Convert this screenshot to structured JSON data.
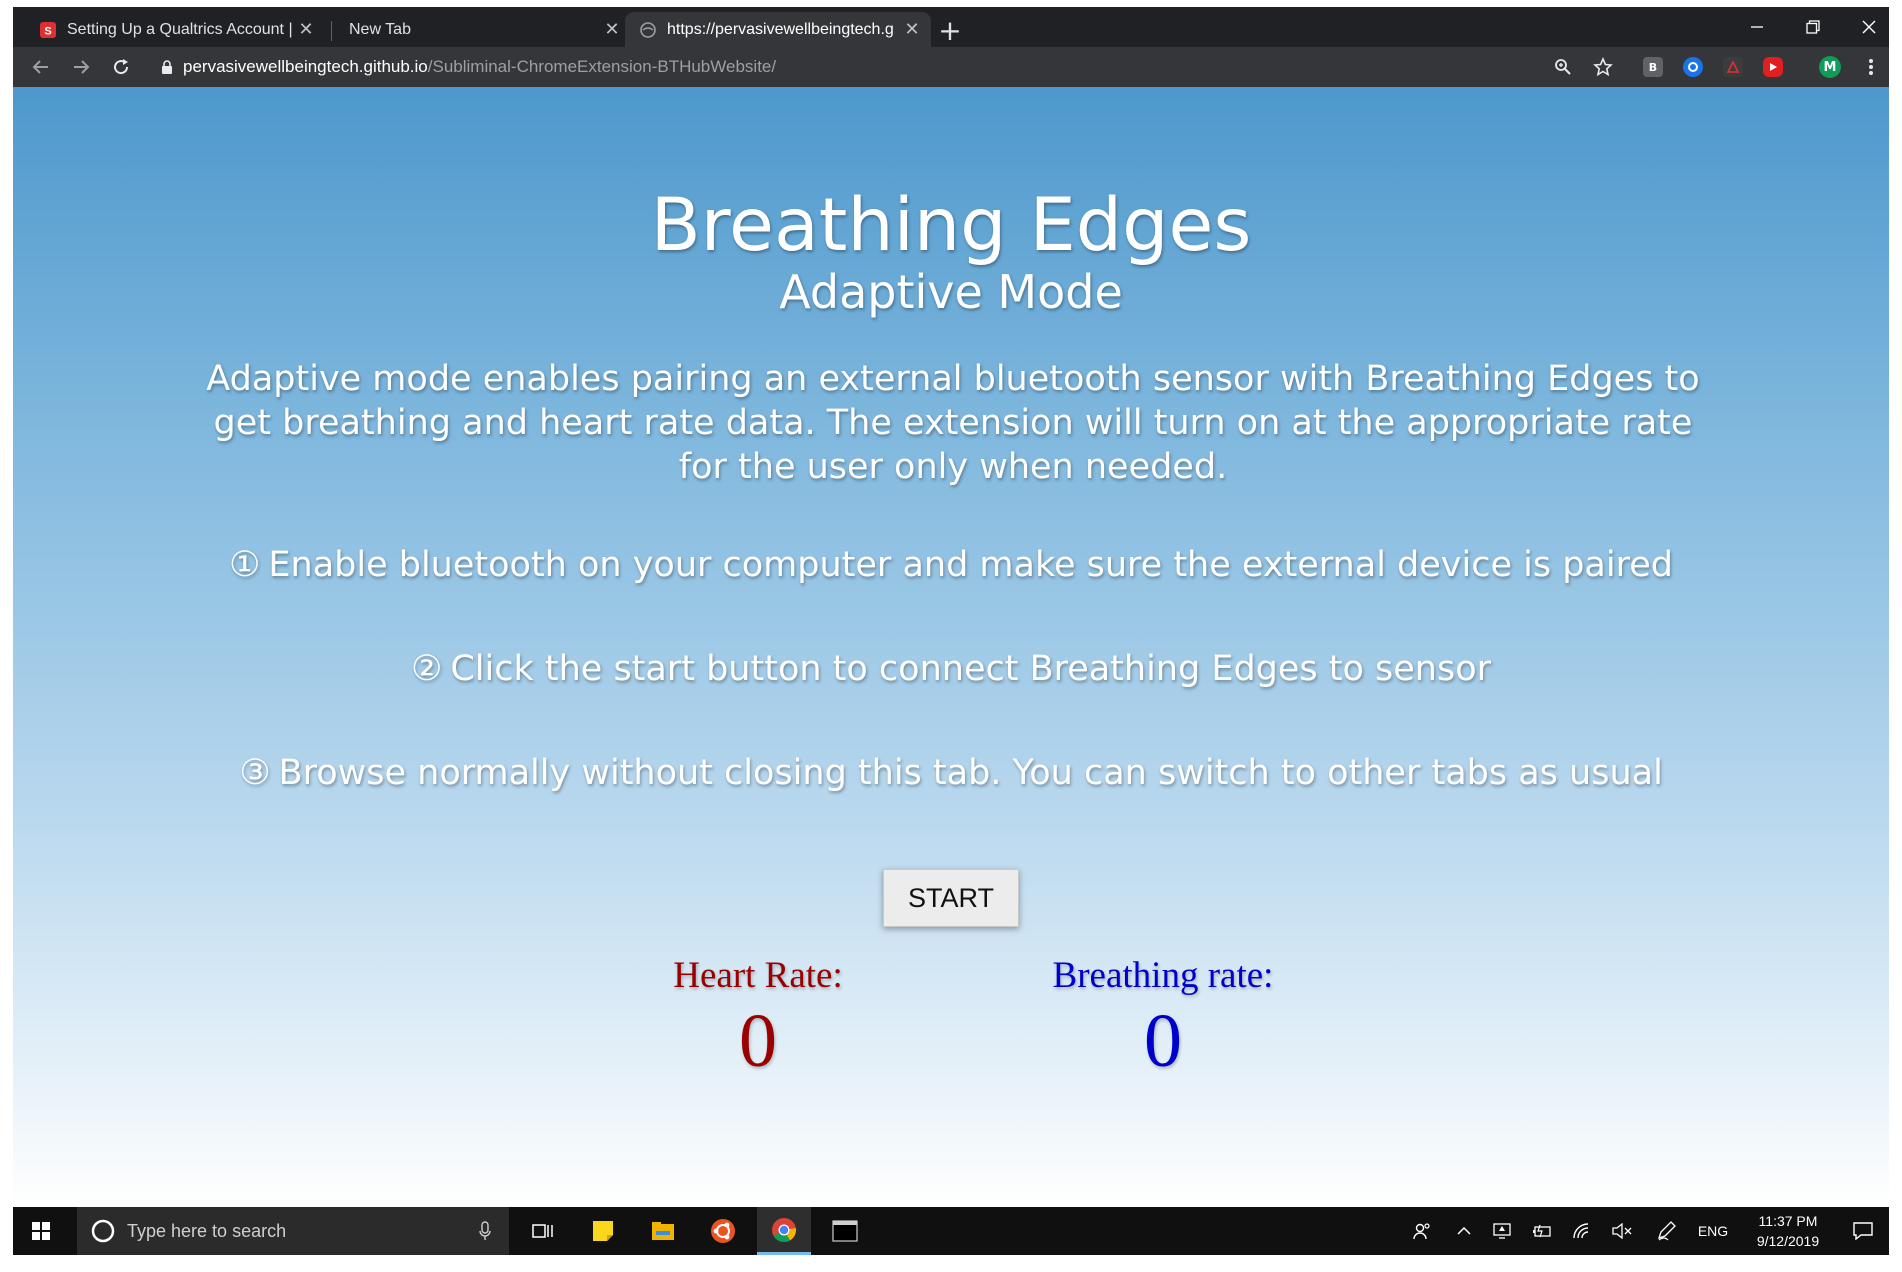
{
  "browser": {
    "tabs": [
      {
        "title": "Setting Up a Qualtrics Account | ",
        "active": false
      },
      {
        "title": "New Tab",
        "active": false
      },
      {
        "title": "https://pervasivewellbeingtech.g",
        "active": true
      }
    ],
    "new_tab_symbol": "+",
    "url_host": "pervasivewellbeingtech.github.io",
    "url_path": "/Subliminal-ChromeExtension-BTHubWebsite/",
    "profile_initial": "M",
    "extension_b_label": "B"
  },
  "page": {
    "title": "Breathing Edges",
    "subtitle": "Adaptive Mode",
    "description": "Adaptive mode enables pairing an external bluetooth sensor with Breathing Edges to get breathing and heart rate data. The extension will turn on at the appropriate rate for the user only when needed.",
    "steps": [
      {
        "num": "①",
        "text": "Enable bluetooth on your computer and make sure the external device is paired"
      },
      {
        "num": "②",
        "text": "Click the start button to connect Breathing Edges to sensor"
      },
      {
        "num": "③",
        "text": "Browse normally without closing this tab. You can switch to other tabs as usual"
      }
    ],
    "start_label": "START",
    "heart_rate": {
      "label": "Heart Rate:",
      "value": "0",
      "color": "#9b0000"
    },
    "breathing_rate": {
      "label": "Breathing rate:",
      "value": "0",
      "color": "#0000cc"
    }
  },
  "taskbar": {
    "search_placeholder": "Type here to search",
    "language": "ENG",
    "time": "11:37 PM",
    "date": "9/12/2019"
  }
}
